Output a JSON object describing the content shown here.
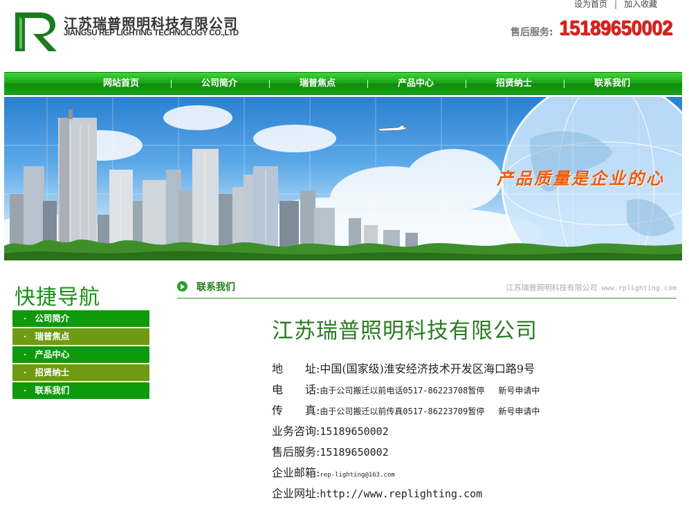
{
  "header": {
    "company_cn": "江苏瑞普照明科技有限公司",
    "company_en": "JIANGSU REP LIGHTING TECHNOLOGY CO.,LTD",
    "links": [
      "设为首页",
      "加入收藏"
    ],
    "hotline_label": "售后服务:",
    "hotline_number": "15189650002"
  },
  "nav": {
    "items": [
      "网站首页",
      "公司简介",
      "瑞普焦点",
      "产品中心",
      "招贤纳士",
      "联系我们"
    ]
  },
  "banner": {
    "slogan": "产品质量是企业的心"
  },
  "sidebar": {
    "title": "快捷导航",
    "bullet": "·",
    "items": [
      "公司简介",
      "瑞普焦点",
      "产品中心",
      "招贤纳士",
      "联系我们"
    ]
  },
  "section": {
    "title": "联系我们",
    "right_text": "江苏瑞普照明科技有限公司",
    "right_url": "www.rplighting.com"
  },
  "contact": {
    "company": "江苏瑞普照明科技有限公司",
    "address_label": "地　　址:",
    "address": "中国(国家级)淮安经济技术开发区海口路9号",
    "phone_label": "电　　话:",
    "phone": "由于公司搬迁以前电话0517-86223708暂停",
    "phone_note": "新号申请中",
    "fax_label": "传　　真:",
    "fax": "由于公司搬迁以前传真0517-86223709暂停",
    "fax_note": "新号申请中",
    "business_label": "业务咨询:",
    "business": "15189650002",
    "service_label": "售后服务:",
    "service": "15189650002",
    "email_label": "企业邮箱:",
    "email": "rep-lighting@163.com",
    "website_label": "企业网址:",
    "website": "http://www.replighting.com"
  },
  "colors": {
    "brand_green": "#1aa215",
    "hotline_red": "#e0201b",
    "slogan_orange": "#f05a0a"
  }
}
